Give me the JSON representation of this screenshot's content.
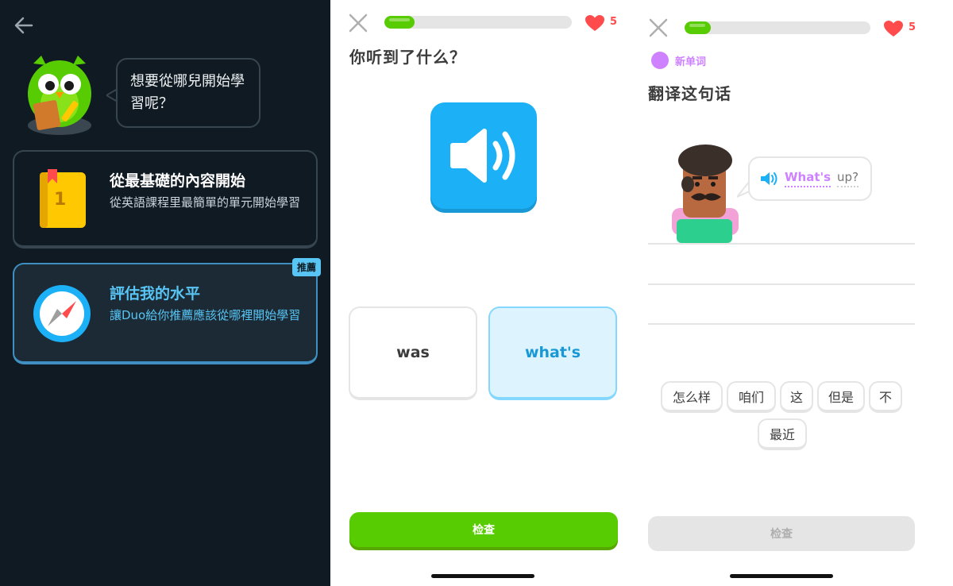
{
  "panel1": {
    "bubble_text": "想要從哪兒開始學習呢？",
    "option_basics": {
      "title": "從最基礎的內容開始",
      "description": "從英語課程里最簡單的單元開始學習",
      "book_number": "1"
    },
    "option_assess": {
      "title": "評估我的水平",
      "description": "讓Duo給你推薦應該從哪裡開始學習",
      "badge": "推薦"
    }
  },
  "panel2": {
    "progress": 0.16,
    "hearts": "5",
    "prompt": "你听到了什么？",
    "choices": [
      {
        "label": "was",
        "selected": false
      },
      {
        "label": "what's",
        "selected": true
      }
    ],
    "check_label": "检查"
  },
  "panel3": {
    "progress": 0.14,
    "hearts": "5",
    "new_word_label": "新单词",
    "title": "翻译这句话",
    "speech_word": "What's",
    "speech_word2": "up?",
    "tiles_row1": [
      "怎么样",
      "咱们",
      "这",
      "但是",
      "不"
    ],
    "tiles_row2": [
      "最近"
    ],
    "check_label": "检查"
  },
  "colors": {
    "dark_bg": "#0f1a22",
    "green": "#58cc02",
    "blue": "#1cb0f6",
    "purple": "#ce82ff",
    "heart_red": "#ff4b4b"
  }
}
